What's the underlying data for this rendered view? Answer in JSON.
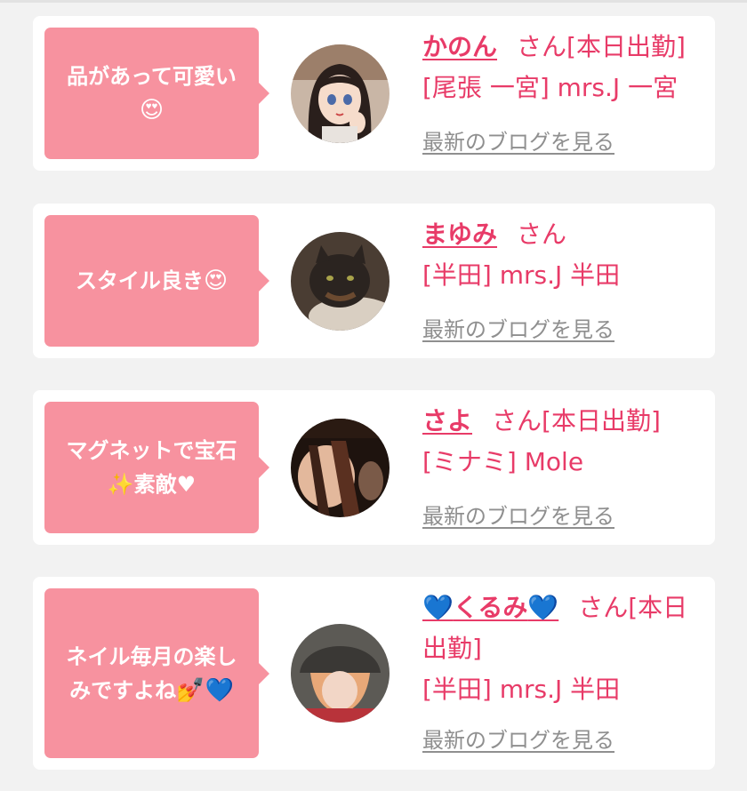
{
  "entries": [
    {
      "comment": "品があって可愛い",
      "comment_emoji": "😍",
      "name": "かのん",
      "suffix": "さん[本日出勤]",
      "line2": "[尾張 一宮] mrs.J 一宮",
      "blog_link": "最新のブログを見る",
      "avatar_icon": "anime-girl-avatar"
    },
    {
      "comment": "スタイル良き",
      "comment_emoji": "😍",
      "name": "まゆみ",
      "suffix": "さん",
      "line2": "[半田] mrs.J 半田",
      "blog_link": "最新のブログを見る",
      "avatar_icon": "cat-photo-avatar"
    },
    {
      "comment": "マグネットで宝石",
      "comment_line2": "✨素敵♥",
      "name": "さよ",
      "suffix": "さん[本日出勤]",
      "line2": "[ミナミ] Mole",
      "blog_link": "最新のブログを見る",
      "avatar_icon": "legs-photo-avatar"
    },
    {
      "comment": "ネイル毎月の楽し",
      "comment_line2": "みですよね",
      "comment_emoji": "💅💙",
      "name_prefix": "💙",
      "name": "くるみ",
      "name_suffix": "💙",
      "suffix": "さん[本日",
      "suffix_line2": "出勤]",
      "line2": "[半田] mrs.J 半田",
      "blog_link": "最新のブログを見る",
      "avatar_icon": "woman-hat-photo-avatar"
    }
  ],
  "colors": {
    "accent": "#e83b68",
    "bubble": "#f7929f",
    "link_gray": "#8f8f8f",
    "background": "#f2f2f2"
  }
}
